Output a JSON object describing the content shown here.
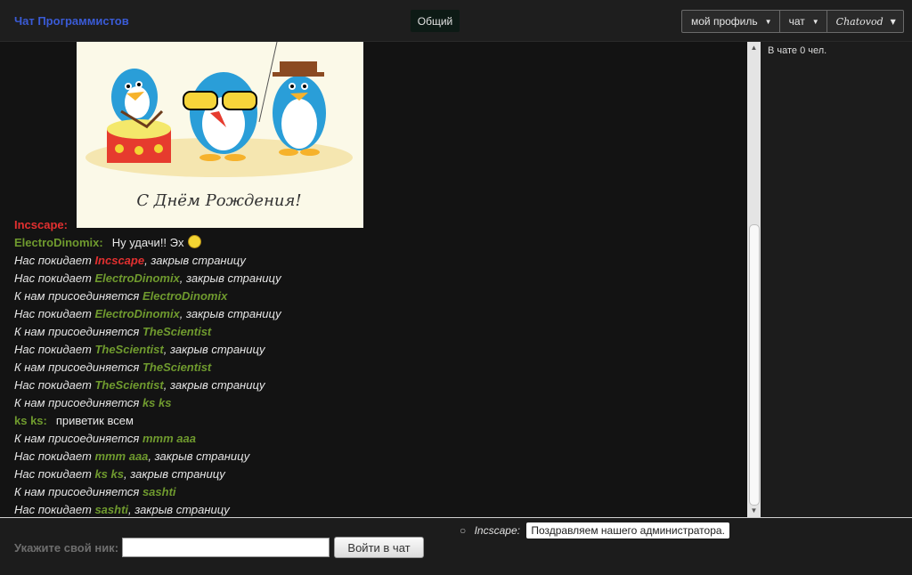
{
  "header": {
    "brand": "Чат Программистов",
    "room_tab": "Общий",
    "menu": [
      {
        "label": "мой профиль"
      },
      {
        "label": "чат"
      },
      {
        "label": "Chatovod"
      }
    ]
  },
  "image": {
    "caption": "С Днём Рождения!"
  },
  "chat": {
    "messages": [
      {
        "type": "msg",
        "author": "Incscape:",
        "author_color": "#e23030",
        "text": ""
      },
      {
        "type": "msg",
        "author": "ElectroDinomix:",
        "author_color": "#6f9a2e",
        "text": "Ну удачи!! Эх",
        "smiley": "sad-smiley"
      },
      {
        "type": "sys",
        "prefix": "Нас покидает ",
        "nick": "Incscape",
        "nick_color": "#e23030",
        "suffix": ", закрыв страницу"
      },
      {
        "type": "sys",
        "prefix": "Нас покидает ",
        "nick": "ElectroDinomix",
        "nick_color": "#6f9a2e",
        "suffix": ", закрыв страницу"
      },
      {
        "type": "sys",
        "prefix": "К нам присоединяется ",
        "nick": "ElectroDinomix",
        "nick_color": "#6f9a2e",
        "suffix": ""
      },
      {
        "type": "sys",
        "prefix": "Нас покидает ",
        "nick": "ElectroDinomix",
        "nick_color": "#6f9a2e",
        "suffix": ", закрыв страницу"
      },
      {
        "type": "sys",
        "prefix": "К нам присоединяется ",
        "nick": "TheScientist",
        "nick_color": "#6f9a2e",
        "suffix": ""
      },
      {
        "type": "sys",
        "prefix": "Нас покидает ",
        "nick": "TheScientist",
        "nick_color": "#6f9a2e",
        "suffix": ", закрыв страницу"
      },
      {
        "type": "sys",
        "prefix": "К нам присоединяется ",
        "nick": "TheScientist",
        "nick_color": "#6f9a2e",
        "suffix": ""
      },
      {
        "type": "sys",
        "prefix": "Нас покидает ",
        "nick": "TheScientist",
        "nick_color": "#6f9a2e",
        "suffix": ", закрыв страницу"
      },
      {
        "type": "sys",
        "prefix": "К нам присоединяется ",
        "nick": "ks ks",
        "nick_color": "#6f9a2e",
        "suffix": ""
      },
      {
        "type": "msg",
        "author": "ks ks:",
        "author_color": "#6f9a2e",
        "text": "приветик всем"
      },
      {
        "type": "sys",
        "prefix": "К нам присоединяется ",
        "nick": "mmm aaa",
        "nick_color": "#6f9a2e",
        "suffix": ""
      },
      {
        "type": "sys",
        "prefix": "Нас покидает ",
        "nick": "mmm aaa",
        "nick_color": "#6f9a2e",
        "suffix": ", закрыв страницу"
      },
      {
        "type": "sys",
        "prefix": "Нас покидает ",
        "nick": "ks ks",
        "nick_color": "#6f9a2e",
        "suffix": ", закрыв страницу"
      },
      {
        "type": "sys",
        "prefix": "К нам присоединяется ",
        "nick": "sashti",
        "nick_color": "#6f9a2e",
        "suffix": ""
      },
      {
        "type": "sys",
        "prefix": "Нас покидает ",
        "nick": "sashti",
        "nick_color": "#6f9a2e",
        "suffix": ", закрыв страницу"
      }
    ]
  },
  "sidebar": {
    "online_count": "В чате 0 чел."
  },
  "footer": {
    "nick_label": "Укажите свой ник:",
    "nick_value": "",
    "join_button": "Войти в чат",
    "preview_author": "Incscape:",
    "preview_text": "Поздравляем нашего администратора."
  }
}
